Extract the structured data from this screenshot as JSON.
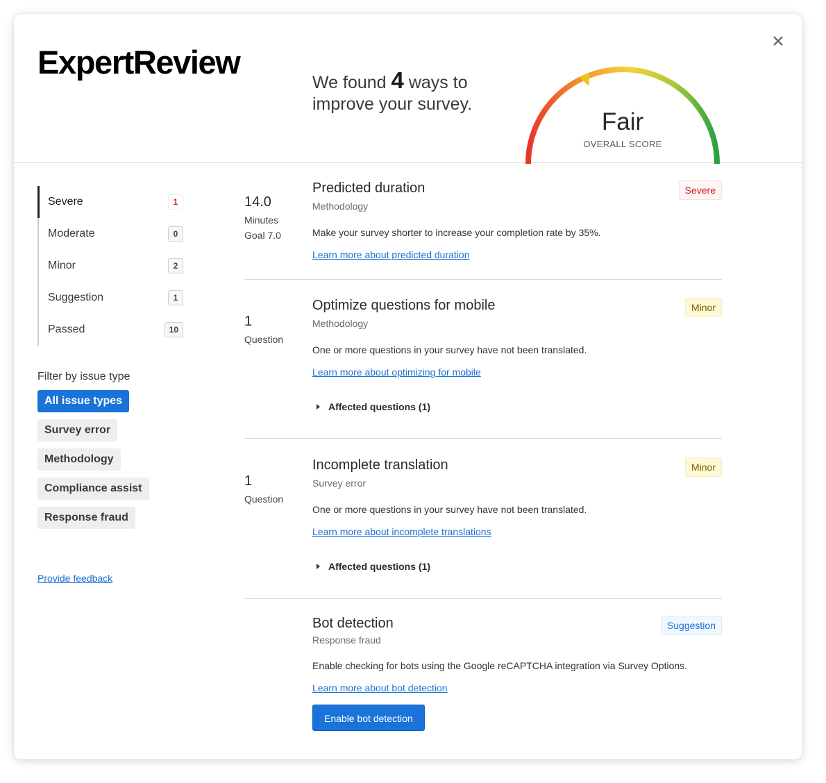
{
  "header": {
    "logo": "ExpertReview",
    "found_prefix": "We found",
    "found_count": "4",
    "found_mid": "ways",
    "found_suffix": "to improve your survey.",
    "score_label": "Fair",
    "score_sub": "OVERALL SCORE",
    "score_level": 0.37,
    "close_icon": "close-icon"
  },
  "sidebar": {
    "severities": [
      {
        "label": "Severe",
        "count": "1"
      },
      {
        "label": "Moderate",
        "count": "0"
      },
      {
        "label": "Minor",
        "count": "2"
      },
      {
        "label": "Suggestion",
        "count": "1"
      },
      {
        "label": "Passed",
        "count": "10"
      }
    ],
    "filter_title": "Filter by issue type",
    "filters": [
      "All issue types",
      "Survey error",
      "Methodology",
      "Compliance assist",
      "Response fraud"
    ],
    "feedback": "Provide feedback"
  },
  "issues": [
    {
      "metric_big": "14.0",
      "metric_small": "Minutes",
      "metric_goal": "Goal 7.0",
      "title": "Predicted duration",
      "category": "Methodology",
      "badge": "Severe",
      "description": "Make your survey shorter to increase your completion rate by 35%.",
      "link": "Learn more about predicted duration"
    },
    {
      "metric_big": "1",
      "metric_small": "Question",
      "title": "Optimize questions for mobile",
      "category": "Methodology",
      "badge": "Minor",
      "description": "One or more questions in your survey have not been translated.",
      "link": "Learn more about optimizing for mobile",
      "affected": "Affected questions (1)"
    },
    {
      "metric_big": "1",
      "metric_small": "Question",
      "title": "Incomplete translation",
      "category": "Survey error",
      "badge": "Minor",
      "description": "One or more questions in your survey have not been translated.",
      "link": "Learn more about incomplete translations",
      "affected": "Affected questions (1)"
    },
    {
      "title": "Bot detection",
      "category": "Response fraud",
      "badge": "Suggestion",
      "description": "Enable checking for bots using the Google reCAPTCHA integration via Survey Options.",
      "link": "Learn more about bot detection",
      "button": "Enable bot detection"
    }
  ],
  "colors": {
    "accent": "#1a73d9",
    "severe": "#d32020",
    "minor": "#7a6200",
    "gauge_red": "#e8352b",
    "gauge_yellow": "#f5d33a",
    "gauge_green": "#2aa043"
  }
}
